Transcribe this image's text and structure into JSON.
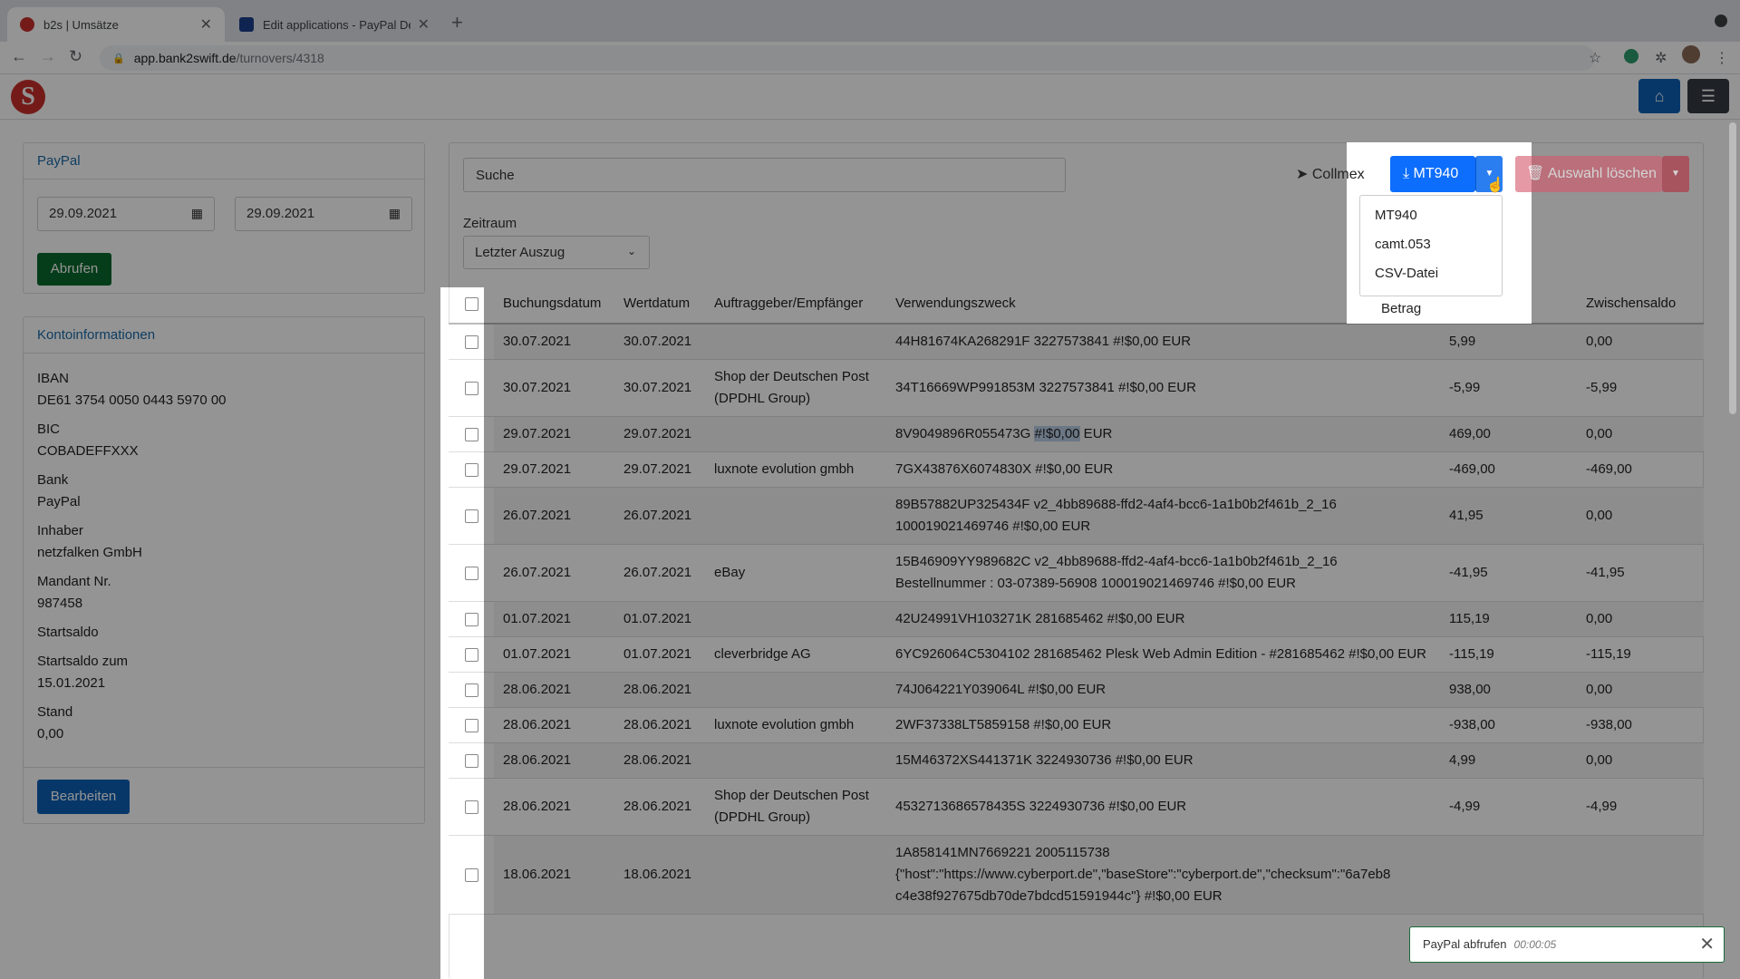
{
  "browser": {
    "tabs": [
      {
        "title": "b2s | Umsätze",
        "active": true
      },
      {
        "title": "Edit applications - PayPal Deve",
        "active": false
      }
    ],
    "url_host": "app.bank2swift.de",
    "url_path": "/turnovers/4318"
  },
  "app": {
    "logo_letter": "S",
    "colors": {
      "brand": "#c9302c",
      "primary": "#0d6efd",
      "success": "#0a6a2e",
      "danger": "#dc3545"
    }
  },
  "fetch_card": {
    "title": "PayPal",
    "date_from": "29.09.2021",
    "date_to": "29.09.2021",
    "fetch_label": "Abrufen"
  },
  "account": {
    "title": "Kontoinformationen",
    "fields": [
      {
        "label": "IBAN",
        "value": "DE61 3754 0050 0443 5970 00"
      },
      {
        "label": "BIC",
        "value": "COBADEFFXXX"
      },
      {
        "label": "Bank",
        "value": "PayPal"
      },
      {
        "label": "Inhaber",
        "value": "netzfalken GmbH"
      },
      {
        "label": "Mandant Nr.",
        "value": "987458"
      },
      {
        "label": "Startsaldo",
        "value": ""
      },
      {
        "label": "Startsaldo zum",
        "value": "15.01.2021"
      },
      {
        "label": "Stand",
        "value": "0,00"
      }
    ],
    "edit_label": "Bearbeiten"
  },
  "toolbar": {
    "search_placeholder": "Suche",
    "period_label": "Zeitraum",
    "period_value": "Letzter Auszug",
    "collmex_label": "Collmex",
    "export_label": "MT940",
    "delete_label": "Auswahl löschen",
    "export_options": [
      "MT940",
      "camt.053",
      "CSV-Datei"
    ]
  },
  "table": {
    "headers": [
      "Buchungsdatum",
      "Wertdatum",
      "Auftraggeber/Empfänger",
      "Verwendungszweck",
      "Betrag",
      "Zwischensaldo"
    ],
    "rows": [
      {
        "buchung": "30.07.2021",
        "wert": "30.07.2021",
        "partner": "",
        "zweck": "44H81674KA268291F 3227573841 #!$0,00 EUR",
        "betrag": "5,99",
        "saldo": "0,00"
      },
      {
        "buchung": "30.07.2021",
        "wert": "30.07.2021",
        "partner": "Shop der Deutschen Post (DPDHL Group)",
        "zweck": "34T16669WP991853M 3227573841 #!$0,00 EUR",
        "betrag": "-5,99",
        "saldo": "-5,99"
      },
      {
        "buchung": "29.07.2021",
        "wert": "29.07.2021",
        "partner": "",
        "zweck_pre": "8V9049896R055473G ",
        "zweck_hl": "#!$0,00",
        "zweck_post": " EUR",
        "betrag": "469,00",
        "saldo": "0,00"
      },
      {
        "buchung": "29.07.2021",
        "wert": "29.07.2021",
        "partner": "luxnote evolution gmbh",
        "zweck": "7GX43876X6074830X #!$0,00 EUR",
        "betrag": "-469,00",
        "saldo": "-469,00"
      },
      {
        "buchung": "26.07.2021",
        "wert": "26.07.2021",
        "partner": "",
        "zweck": "89B57882UP325434F v2_4bb89688-ffd2-4af4-bcc6-1a1b0b2f461b_2_16 100019021469746 #!$0,00 EUR",
        "betrag": "41,95",
        "saldo": "0,00"
      },
      {
        "buchung": "26.07.2021",
        "wert": "26.07.2021",
        "partner": "eBay",
        "zweck": "15B46909YY989682C v2_4bb89688-ffd2-4af4-bcc6-1a1b0b2f461b_2_16 Bestellnummer : 03-07389-56908 100019021469746 #!$0,00 EUR",
        "betrag": "-41,95",
        "saldo": "-41,95"
      },
      {
        "buchung": "01.07.2021",
        "wert": "01.07.2021",
        "partner": "",
        "zweck": "42U24991VH103271K 281685462 #!$0,00 EUR",
        "betrag": "115,19",
        "saldo": "0,00"
      },
      {
        "buchung": "01.07.2021",
        "wert": "01.07.2021",
        "partner": "cleverbridge AG",
        "zweck": "6YC926064C5304102 281685462 Plesk Web Admin Edition - #281685462 #!$0,00 EUR",
        "betrag": "-115,19",
        "saldo": "-115,19"
      },
      {
        "buchung": "28.06.2021",
        "wert": "28.06.2021",
        "partner": "",
        "zweck": "74J064221Y039064L #!$0,00 EUR",
        "betrag": "938,00",
        "saldo": "0,00"
      },
      {
        "buchung": "28.06.2021",
        "wert": "28.06.2021",
        "partner": "luxnote evolution gmbh",
        "zweck": "2WF37338LT5859158 #!$0,00 EUR",
        "betrag": "-938,00",
        "saldo": "-938,00"
      },
      {
        "buchung": "28.06.2021",
        "wert": "28.06.2021",
        "partner": "",
        "zweck": "15M46372XS441371K 3224930736 #!$0,00 EUR",
        "betrag": "4,99",
        "saldo": "0,00"
      },
      {
        "buchung": "28.06.2021",
        "wert": "28.06.2021",
        "partner": "Shop der Deutschen Post (DPDHL Group)",
        "zweck": "4532713686578435S 3224930736 #!$0,00 EUR",
        "betrag": "-4,99",
        "saldo": "-4,99"
      },
      {
        "buchung": "18.06.2021",
        "wert": "18.06.2021",
        "partner": "",
        "zweck": "1A858141MN7669221 2005115738 {\"host\":\"https://www.cyberport.de\",\"baseStore\":\"cyberport.de\",\"checksum\":\"6a7eb8 c4e38f927675db70de7bdcd51591944c\"} #!$0,00 EUR",
        "betrag": "",
        "saldo": ""
      }
    ]
  },
  "toast": {
    "text": "PayPal abfrufen",
    "time": "00:00:05"
  }
}
